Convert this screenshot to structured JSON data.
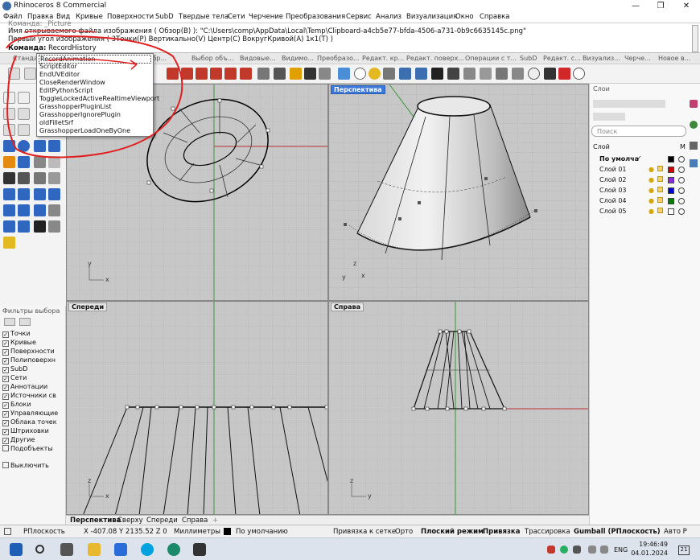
{
  "window": {
    "title": "Rhinoceros 8 Commercial",
    "minimize": "—",
    "restore": "❐",
    "close": "✕"
  },
  "menu": [
    "Файл",
    "Правка",
    "Вид",
    "Кривые",
    "Поверхности",
    "SubD",
    "Твердые тела",
    "Сети",
    "Черчение",
    "Преобразования",
    "Сервис",
    "Анализ",
    "Визуализация",
    "Окно",
    "Справка"
  ],
  "command_history": {
    "line0": "Команда: _Picture",
    "line1": "Имя открываемого файла изображения ( Обзор(B) ): \"C:\\Users\\comp\\AppData\\Local\\Temp\\Clipboard-a4cb5e77-bfda-4506-a731-0b9c6635145c.png\"",
    "line2": "Первый угол изображения ( 3Точки(P)  Вертикально(V)  Центр(C)  ВокругКривой(A)  1к1(T) )",
    "prompt_label": "Команда:",
    "prompt_value": "RecordHistory"
  },
  "toolbar_tabs": [
    "Стандарт",
    "...",
    "отобр...",
    "Выбор объ...",
    "Видовые...",
    "Видимо...",
    "Преобразо...",
    "Редакт. кр...",
    "Редакт. поверх...",
    "Операции с т...",
    "SubD",
    "Редакт. с...",
    "Визуализ...",
    "Черче...",
    "Новое в..."
  ],
  "autocomplete": [
    "RecordAnimation",
    "ScriptEditor",
    "EndUVEditor",
    "CloseRenderWindow",
    "EditPythonScript",
    "ToggleLockedActiveRealtimeViewport",
    "GrasshopperPluginList",
    "GrasshopperIgnorePlugin",
    "oldFilletSrf",
    "GrasshopperLoadOneByOne"
  ],
  "viewports": {
    "top_label": "Сверху",
    "perspective": "Перспектива",
    "front": "Спереди",
    "right": "Справа",
    "axis_x": "x",
    "axis_y": "y",
    "axis_z": "z"
  },
  "viewport_tabs": [
    "Перспектива",
    "Сверху",
    "Спереди",
    "Справа",
    "+"
  ],
  "filters": {
    "title": "Фильтры выбора",
    "items": [
      {
        "label": "Точки",
        "checked": true
      },
      {
        "label": "Кривые",
        "checked": true
      },
      {
        "label": "Поверхности",
        "checked": true
      },
      {
        "label": "Полиповерхн",
        "checked": true
      },
      {
        "label": "SubD",
        "checked": true
      },
      {
        "label": "Сети",
        "checked": true
      },
      {
        "label": "Аннотации",
        "checked": true
      },
      {
        "label": "Источники св",
        "checked": true
      },
      {
        "label": "Блоки",
        "checked": true
      },
      {
        "label": "Управляющие",
        "checked": true
      },
      {
        "label": "Облака точек",
        "checked": true
      },
      {
        "label": "Штриховки",
        "checked": true
      },
      {
        "label": "Другие",
        "checked": true
      },
      {
        "label": "Подобъекты",
        "checked": false
      },
      {
        "label": "Выключить",
        "checked": false
      }
    ],
    "check_mark": "✓"
  },
  "layers": {
    "title": "Слои",
    "search_placeholder": "Поиск",
    "column_layer": "Слой",
    "column_m": "М",
    "rows": [
      {
        "name": "По умолча",
        "current": "✓",
        "color": "#000000"
      },
      {
        "name": "Слой 01",
        "color": "#cc0000"
      },
      {
        "name": "Слой 02",
        "color": "#8a2be2"
      },
      {
        "name": "Слой 03",
        "color": "#0000cc"
      },
      {
        "name": "Слой 04",
        "color": "#008000"
      },
      {
        "name": "Слой 05",
        "color": "#ffffff"
      }
    ],
    "bulb": "💡"
  },
  "status": {
    "cplane": "РПлоскость",
    "coords": "X -407.08 Y 2135.52 Z 0",
    "units": "Миллиметры",
    "layer": "По умолчанию",
    "grid_snap": "Привязка к сетке",
    "ortho": "Орто",
    "planar": "Плоский режим",
    "osnap": "Привязка",
    "smarttrack": "Трассировка",
    "gumball": "Gumball (РПлоскость)",
    "autocplane": "Авто Р"
  },
  "taskbar": {
    "time": "19:46:49",
    "date": "04.01.2024",
    "lang": "ENG",
    "notif": "21"
  }
}
